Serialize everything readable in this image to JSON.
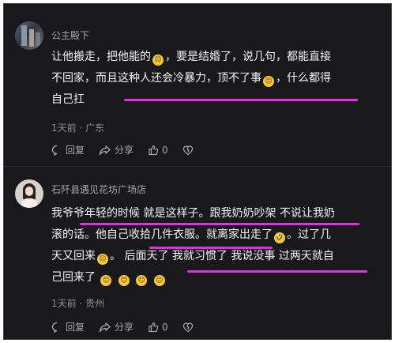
{
  "comments": [
    {
      "username": "公主殿下",
      "lines": [
        "让他搬走，把他能的",
        "，要是结婚了，说几句，都能直接",
        "不回家，而且这种人还会冷暴力，顶不了事",
        "，什么都得",
        "自己扛"
      ],
      "emoji": [
        "😊",
        "😊"
      ],
      "time_label": "1天前",
      "location": "广东",
      "reply_label": "回复",
      "share_label": "分享",
      "like_count": "0"
    },
    {
      "username": "石阡县遇见花坊广场店",
      "lines": [
        "我爷爷年轻的时候 就是这样子。跟我奶奶吵架 不说让我奶",
        "滚的话。他自己收拾几件衣服。就离家出走了",
        "。过了几",
        "天又回来",
        "。 后面天了 我就习惯了 我说没事 过两天就自",
        "己回来了"
      ],
      "emoji": [
        "🤣",
        "😊",
        "😊",
        "😊",
        "😊",
        "😊"
      ],
      "time_label": "1天前",
      "location": "贵州",
      "reply_label": "回复",
      "share_label": "分享",
      "like_count": "0"
    }
  ],
  "highlight_color": "#e030e0"
}
